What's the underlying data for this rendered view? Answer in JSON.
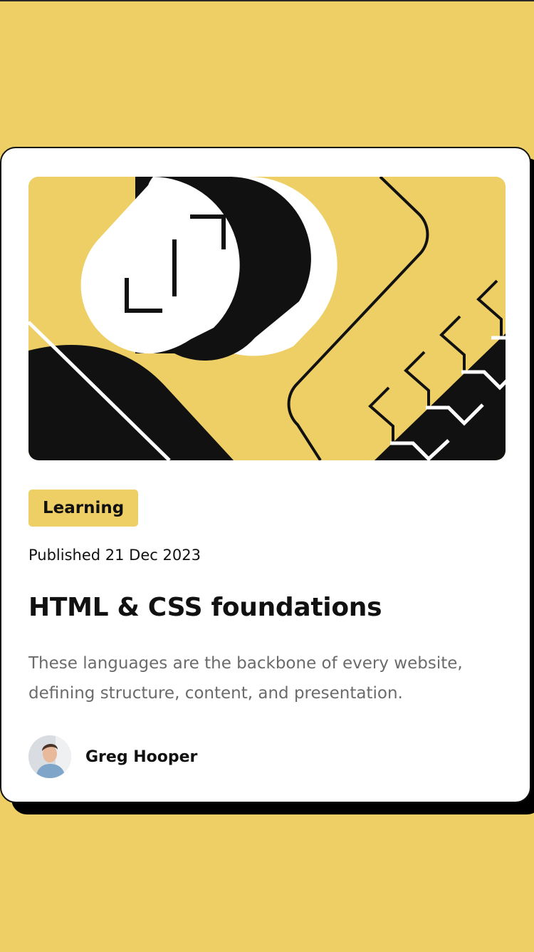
{
  "card": {
    "tag_label": "Learning",
    "published": "Published 21 Dec 2023",
    "title": "HTML & CSS foundations",
    "description": "These languages are the backbone of every website, defining structure, content, and presentation."
  },
  "author": {
    "name": "Greg Hooper"
  },
  "colors": {
    "background": "#EDCF66",
    "card": "#FFFFFF",
    "ink": "#111111",
    "muted_text": "#6B6B6B"
  }
}
